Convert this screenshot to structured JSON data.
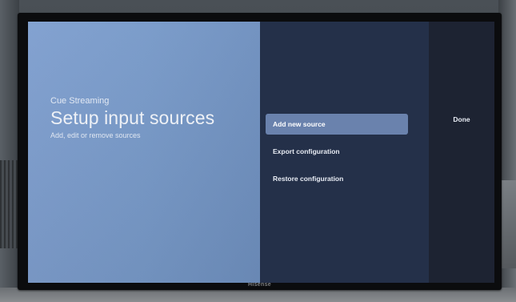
{
  "device": {
    "brand_logo": "Hisense"
  },
  "setup": {
    "app_name": "Cue Streaming",
    "title": "Setup input sources",
    "subtitle": "Add, edit or remove sources"
  },
  "menu": {
    "items": [
      {
        "label": "Add new source",
        "focused": true
      },
      {
        "label": "Export configuration",
        "focused": false
      },
      {
        "label": "Restore configuration",
        "focused": false
      }
    ]
  },
  "side": {
    "done_label": "Done"
  },
  "colors": {
    "left_panel": "#7a9ccb",
    "middle_panel": "#243049",
    "side_panel": "#1d2332",
    "focused_item": "#6a82ad"
  }
}
